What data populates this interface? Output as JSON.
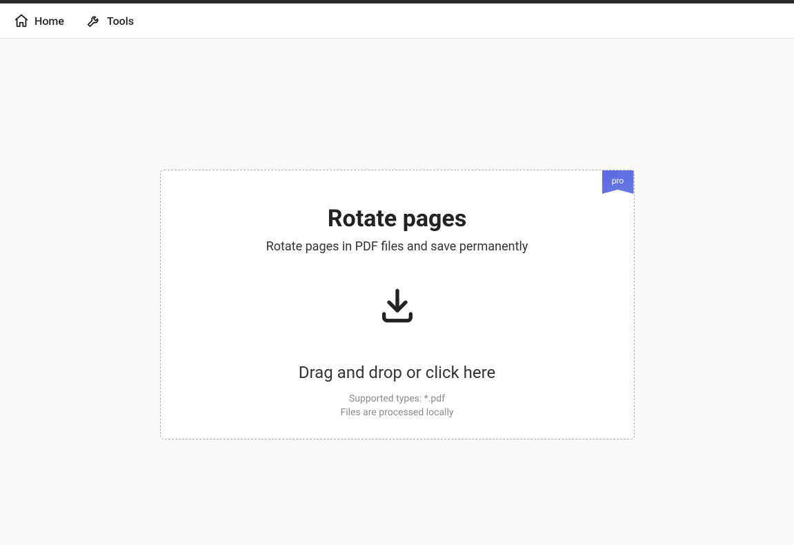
{
  "nav": {
    "home_label": "Home",
    "tools_label": "Tools"
  },
  "card": {
    "badge": "pro",
    "title": "Rotate pages",
    "subtitle": "Rotate pages in PDF files and save permanently",
    "drop_instruction": "Drag and drop or click here",
    "supported": "Supported types: *.pdf",
    "privacy": "Files are processed locally"
  }
}
